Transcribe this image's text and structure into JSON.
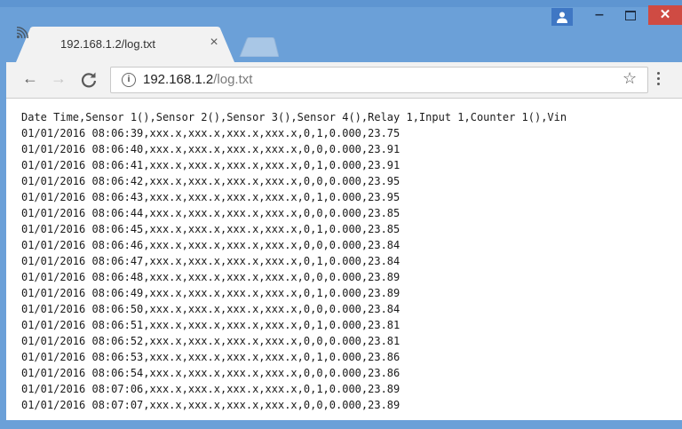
{
  "tab": {
    "title": "192.168.1.2/log.txt",
    "close_glyph": "×",
    "favicon": "wifi-signal-icon"
  },
  "window_controls": {
    "minimize": "‒",
    "close": "✕"
  },
  "toolbar": {
    "back": "←",
    "forward": "→",
    "info": "i",
    "url_host": "192.168.1.2",
    "url_path": "/log.txt",
    "star": "☆"
  },
  "log": {
    "header": "Date Time,Sensor 1(),Sensor 2(),Sensor 3(),Sensor 4(),Relay 1,Input 1,Counter 1(),Vin",
    "lines": [
      "01/01/2016 08:06:39,xxx.x,xxx.x,xxx.x,xxx.x,0,1,0.000,23.75",
      "01/01/2016 08:06:40,xxx.x,xxx.x,xxx.x,xxx.x,0,0,0.000,23.91",
      "01/01/2016 08:06:41,xxx.x,xxx.x,xxx.x,xxx.x,0,1,0.000,23.91",
      "01/01/2016 08:06:42,xxx.x,xxx.x,xxx.x,xxx.x,0,0,0.000,23.95",
      "01/01/2016 08:06:43,xxx.x,xxx.x,xxx.x,xxx.x,0,1,0.000,23.95",
      "01/01/2016 08:06:44,xxx.x,xxx.x,xxx.x,xxx.x,0,0,0.000,23.85",
      "01/01/2016 08:06:45,xxx.x,xxx.x,xxx.x,xxx.x,0,1,0.000,23.85",
      "01/01/2016 08:06:46,xxx.x,xxx.x,xxx.x,xxx.x,0,0,0.000,23.84",
      "01/01/2016 08:06:47,xxx.x,xxx.x,xxx.x,xxx.x,0,1,0.000,23.84",
      "01/01/2016 08:06:48,xxx.x,xxx.x,xxx.x,xxx.x,0,0,0.000,23.89",
      "01/01/2016 08:06:49,xxx.x,xxx.x,xxx.x,xxx.x,0,1,0.000,23.89",
      "01/01/2016 08:06:50,xxx.x,xxx.x,xxx.x,xxx.x,0,0,0.000,23.84",
      "01/01/2016 08:06:51,xxx.x,xxx.x,xxx.x,xxx.x,0,1,0.000,23.81",
      "01/01/2016 08:06:52,xxx.x,xxx.x,xxx.x,xxx.x,0,0,0.000,23.81",
      "01/01/2016 08:06:53,xxx.x,xxx.x,xxx.x,xxx.x,0,1,0.000,23.86",
      "01/01/2016 08:06:54,xxx.x,xxx.x,xxx.x,xxx.x,0,0,0.000,23.86",
      "01/01/2016 08:07:06,xxx.x,xxx.x,xxx.x,xxx.x,0,1,0.000,23.89",
      "01/01/2016 08:07:07,xxx.x,xxx.x,xxx.x,xxx.x,0,0,0.000,23.89"
    ]
  },
  "colors": {
    "frame": "#6ba0d8",
    "close_button": "#cf4b43",
    "toolbar": "#f2f2f2"
  }
}
